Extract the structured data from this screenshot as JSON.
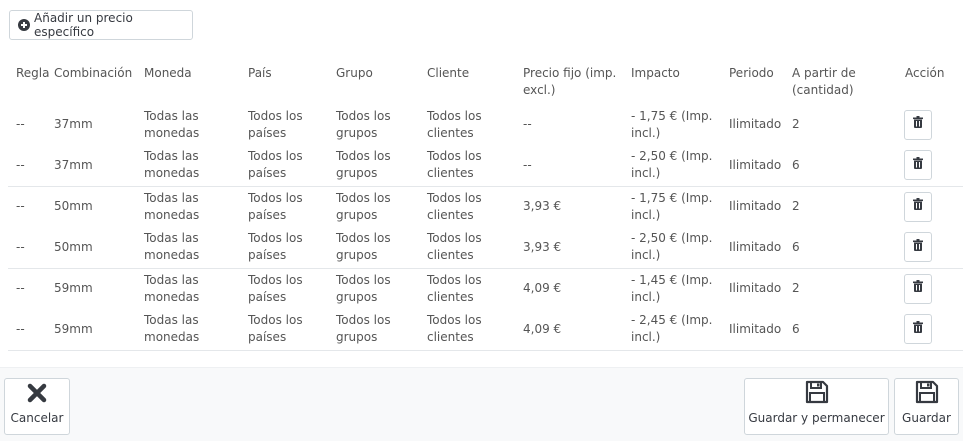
{
  "add_button": {
    "label": "Añadir un precio específico",
    "icon": "plus-circle-icon"
  },
  "table": {
    "headers": [
      "Regla",
      "Combinación",
      "Moneda",
      "País",
      "Grupo",
      "Cliente",
      "Precio fijo (imp. excl.)",
      "Impacto",
      "Periodo",
      "A partir de (cantidad)",
      "Acción"
    ],
    "rows": [
      [
        "--",
        "37mm",
        "Todas las monedas",
        "Todos los países",
        "Todos los grupos",
        "Todos los clientes",
        "--",
        "- 1,75 € (Imp. incl.)",
        "Ilimitado",
        "2"
      ],
      [
        "--",
        "37mm",
        "Todas las monedas",
        "Todos los países",
        "Todos los grupos",
        "Todos los clientes",
        "--",
        "- 2,50 € (Imp. incl.)",
        "Ilimitado",
        "6"
      ],
      [
        "--",
        "50mm",
        "Todas las monedas",
        "Todos los países",
        "Todos los grupos",
        "Todos los clientes",
        "3,93 €",
        "- 1,75 € (Imp. incl.)",
        "Ilimitado",
        "2"
      ],
      [
        "--",
        "50mm",
        "Todas las monedas",
        "Todos los países",
        "Todos los grupos",
        "Todos los clientes",
        "3,93 €",
        "- 2,50 € (Imp. incl.)",
        "Ilimitado",
        "6"
      ],
      [
        "--",
        "59mm",
        "Todas las monedas",
        "Todos los países",
        "Todos los grupos",
        "Todos los clientes",
        "4,09 €",
        "- 1,45 € (Imp. incl.)",
        "Ilimitado",
        "2"
      ],
      [
        "--",
        "59mm",
        "Todas las monedas",
        "Todos los países",
        "Todos los grupos",
        "Todos los clientes",
        "4,09 €",
        "- 2,45 € (Imp. incl.)",
        "Ilimitado",
        "6"
      ]
    ],
    "action_icon": "trash-icon"
  },
  "footer": {
    "cancel_label": "Cancelar",
    "save_stay_label": "Guardar y permanecer",
    "save_label": "Guardar"
  },
  "colors": {
    "text": "#555555",
    "button_text": "#363a41",
    "border": "#cfd6db",
    "footer_bg": "#f8f9fa"
  }
}
